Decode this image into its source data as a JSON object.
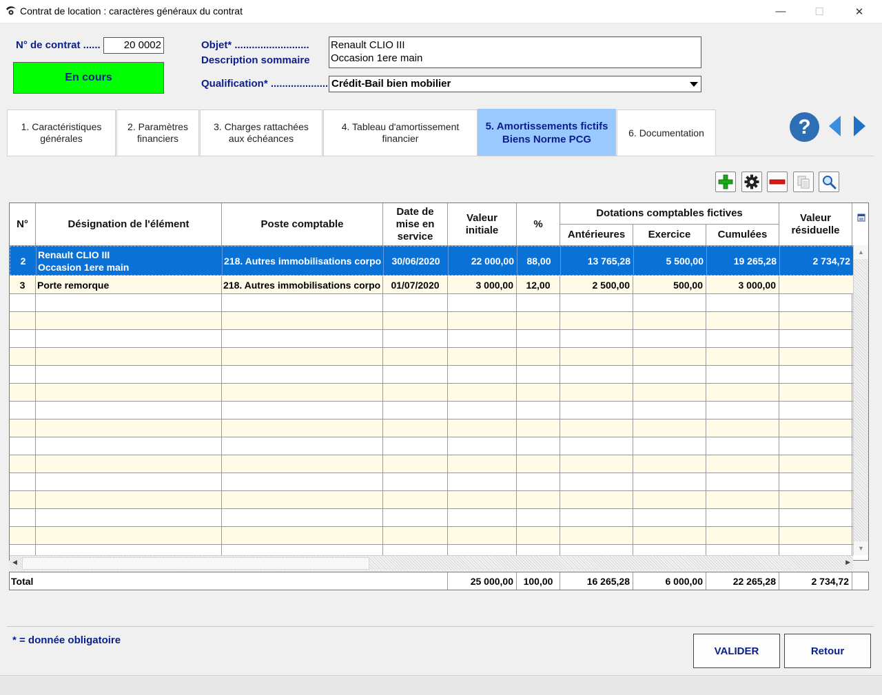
{
  "window": {
    "title": "Contrat de location : caractères généraux du contrat",
    "minimize": "—",
    "maximize": "☐",
    "close": "✕"
  },
  "header": {
    "contract_label": "N° de contrat ......",
    "contract_number": "20 0002",
    "status": "En cours",
    "status_color": "#00ff00",
    "objet_label": "Objet* ..........................",
    "description_label": "Description sommaire",
    "objet_lines": [
      "Renault CLIO III",
      "Occasion 1ere main"
    ],
    "qualification_label": "Qualification* .....................",
    "qualification_value": "Crédit-Bail bien mobilier"
  },
  "tabs": [
    {
      "line1": "1. Caractéristiques",
      "line2": "générales"
    },
    {
      "line1": "2. Paramètres",
      "line2": "financiers"
    },
    {
      "line1": "3. Charges rattachées",
      "line2": "aux échéances"
    },
    {
      "line1": "4. Tableau d'amortissement",
      "line2": "financier"
    },
    {
      "line1": "5. Amortissements fictifs",
      "line2": "Biens Norme PCG",
      "active": true
    },
    {
      "line1": "6. Documentation",
      "line2": ""
    }
  ],
  "icons": {
    "help": "?",
    "toolbar": [
      "add-icon",
      "settings-icon",
      "remove-icon",
      "copy-icon",
      "search-icon"
    ]
  },
  "table": {
    "headers": {
      "num": "N°",
      "designation": "Désignation de l'élément",
      "poste": "Poste comptable",
      "date": "Date de mise en service",
      "valeur_initiale": "Valeur initiale",
      "pct": "%",
      "dotations_group": "Dotations comptables fictives",
      "anterieures": "Antérieures",
      "exercice": "Exercice",
      "cumulees": "Cumulées",
      "valeur_residuelle": "Valeur résiduelle"
    },
    "rows": [
      {
        "num": "2",
        "designation": [
          "Renault CLIO III",
          "Occasion 1ere main"
        ],
        "poste": "218. Autres immobilisations corpo",
        "date": "30/06/2020",
        "valeur_initiale": "22 000,00",
        "pct": "88,00",
        "anterieures": "13 765,28",
        "exercice": "5 500,00",
        "cumulees": "19 265,28",
        "valeur_residuelle": "2 734,72"
      },
      {
        "num": "3",
        "designation": [
          "Porte remorque"
        ],
        "poste": "218. Autres immobilisations corpo",
        "date": "01/07/2020",
        "valeur_initiale": "3 000,00",
        "pct": "12,00",
        "anterieures": "2 500,00",
        "exercice": "500,00",
        "cumulees": "3 000,00",
        "valeur_residuelle": ""
      }
    ],
    "total": {
      "label": "Total",
      "valeur_initiale": "25 000,00",
      "pct": "100,00",
      "anterieures": "16 265,28",
      "exercice": "6 000,00",
      "cumulees": "22 265,28",
      "valeur_residuelle": "2 734,72"
    }
  },
  "footer": {
    "required_note": "* = donnée obligatoire",
    "validate": "VALIDER",
    "back": "Retour"
  },
  "colors": {
    "selected_row": "#0a72d6",
    "odd_row": "#fffbe6",
    "label_blue": "#0a1e8c",
    "active_tab": "#99c9ff"
  }
}
